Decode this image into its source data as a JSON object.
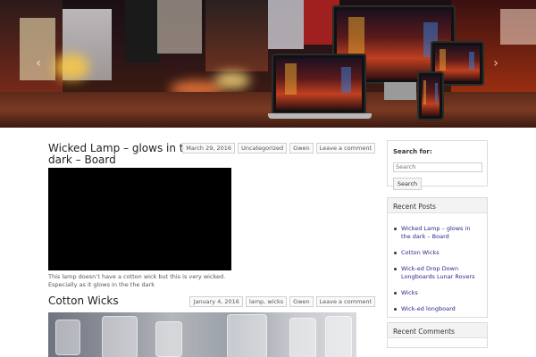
{
  "hero": {
    "prev_icon": "‹",
    "next_icon": "›"
  },
  "posts": [
    {
      "title": "Wicked Lamp – glows in the dark – Board",
      "meta": [
        "March 29, 2016",
        "Uncategorized",
        "Gwen",
        "Leave a comment"
      ],
      "excerpt": "This lamp doesn’t have a cotton wick but this is very wicked. Especially as it glows in the the dark"
    },
    {
      "title": "Cotton Wicks",
      "meta": [
        "January 4, 2016",
        "lamp, wicks",
        "Gwen",
        "Leave a comment"
      ]
    }
  ],
  "sidebar": {
    "search": {
      "label": "Search for:",
      "placeholder": "Search",
      "button_label": "Search"
    },
    "recent_posts": {
      "title": "Recent Posts",
      "items": [
        "Wicked Lamp – glows in the dark – Board",
        "Cotton Wicks",
        "Wick-ed Drop Down Longboards Lunar Rovers",
        "Wicks",
        "Wick-ed longboard"
      ]
    },
    "recent_comments": {
      "title": "Recent Comments"
    }
  },
  "colors": {
    "link": "#2a2a8a",
    "border": "#dcdcdc",
    "widget_head_bg": "#f3f3f3"
  }
}
